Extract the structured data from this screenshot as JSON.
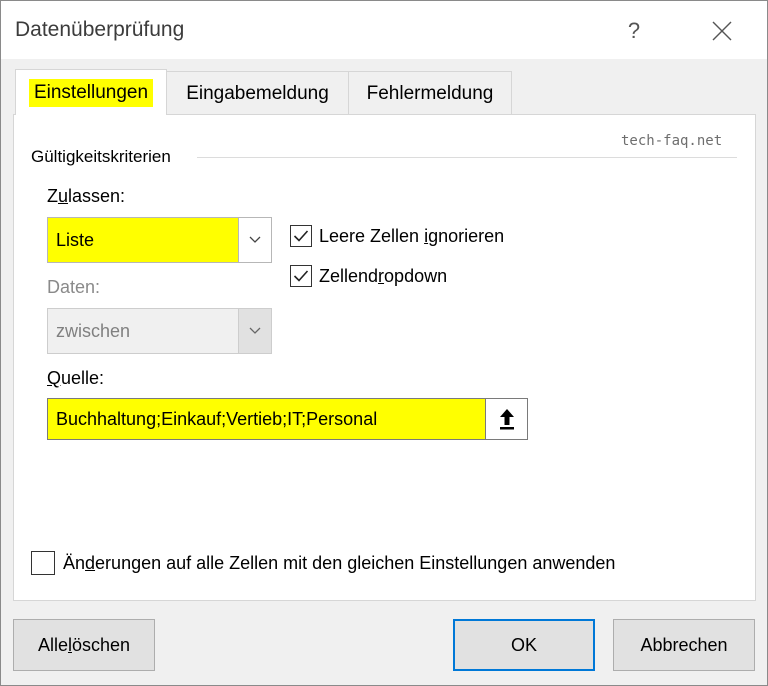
{
  "window": {
    "title": "Datenüberprüfung",
    "help_label": "?",
    "close_icon": "close-icon"
  },
  "tabs": [
    {
      "label": "Einstellungen",
      "active": true,
      "highlighted": true
    },
    {
      "label": "Eingabemeldung",
      "active": false
    },
    {
      "label": "Fehlermeldung",
      "active": false
    }
  ],
  "watermark": "tech-faq.net",
  "criteria": {
    "group_label": "Gültigkeitskriterien",
    "allow": {
      "label_pre": "Z",
      "label_u": "u",
      "label_post": "lassen:",
      "value": "Liste"
    },
    "data": {
      "label": "Daten:",
      "value": "zwischen"
    },
    "ignore_blank": {
      "label_pre": "Leere Zellen ",
      "label_u": "i",
      "label_post": "gnorieren",
      "checked": true
    },
    "in_cell_dropdown": {
      "label_pre": "Zellend",
      "label_u": "r",
      "label_post": "opdown",
      "checked": true
    },
    "source": {
      "label_u": "Q",
      "label_post": "uelle:",
      "value": "Buchhaltung;Einkauf;Vertieb;IT;Personal",
      "ref_icon": "up-arrow-icon"
    }
  },
  "apply_all": {
    "label_pre": "Än",
    "label_u": "d",
    "label_post": "erungen auf alle Zellen mit den gleichen Einstellungen anwenden",
    "checked": false
  },
  "buttons": {
    "clear_pre": "Alle ",
    "clear_u": "l",
    "clear_post": "öschen",
    "ok": "OK",
    "cancel": "Abbrechen"
  },
  "colors": {
    "highlight": "#ffff00",
    "default_button_border": "#0078d7",
    "dialog_background": "#f0f0f0"
  }
}
